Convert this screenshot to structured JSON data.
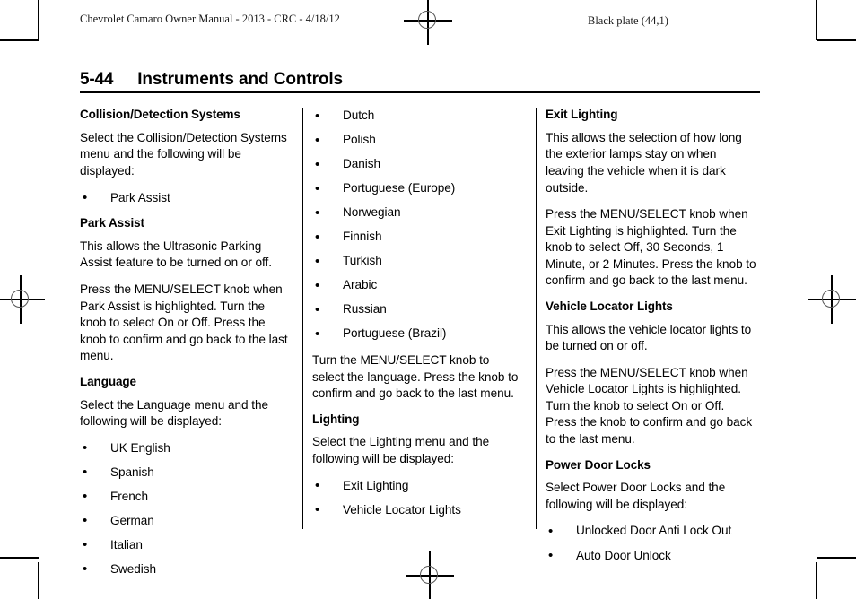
{
  "page": {
    "running_head_left": "Chevrolet Camaro Owner Manual - 2013 - CRC - 4/18/12",
    "running_head_right": "Black plate (44,1)",
    "folio": "5-44",
    "chapter_title": "Instruments and Controls",
    "bullet_glyph": "•"
  },
  "columns": {
    "left": {
      "heading_collision": "Collision/Detection Systems",
      "collision_intro": "Select the Collision/Detection Systems menu and the following will be displayed:",
      "collision_items": [
        "Park Assist"
      ],
      "heading_park_assist": "Park Assist",
      "park_assist_p1": "This allows the Ultrasonic Parking Assist feature to be turned on or off.",
      "park_assist_p2": "Press the MENU/SELECT knob when Park Assist is highlighted. Turn the knob to select On or Off. Press the knob to confirm and go back to the last menu.",
      "heading_language": "Language",
      "language_intro": "Select the Language menu and the following will be displayed:",
      "language_items": [
        "UK English",
        "Spanish",
        "French",
        "German",
        "Italian",
        "Swedish"
      ]
    },
    "middle": {
      "language_items_cont": [
        "Dutch",
        "Polish",
        "Danish",
        "Portuguese (Europe)",
        "Norwegian",
        "Finnish",
        "Turkish",
        "Arabic",
        "Russian",
        "Portuguese (Brazil)"
      ],
      "language_outro": "Turn the MENU/SELECT knob to select the language. Press the knob to confirm and go back to the last menu.",
      "heading_lighting": "Lighting",
      "lighting_intro": "Select the Lighting menu and the following will be displayed:",
      "lighting_items": [
        "Exit Lighting",
        "Vehicle Locator Lights"
      ]
    },
    "right": {
      "heading_exit_lighting": "Exit Lighting",
      "exit_lighting_p1": "This allows the selection of how long the exterior lamps stay on when leaving the vehicle when it is dark outside.",
      "exit_lighting_p2": "Press the MENU/SELECT knob when Exit Lighting is highlighted. Turn the knob to select Off, 30 Seconds, 1 Minute, or 2 Minutes. Press the knob to confirm and go back to the last menu.",
      "heading_vehicle_locator": "Vehicle Locator Lights",
      "vehicle_locator_p1": "This allows the vehicle locator lights to be turned on or off.",
      "vehicle_locator_p2": "Press the MENU/SELECT knob when Vehicle Locator Lights is highlighted. Turn the knob to select On or Off. Press the knob to confirm and go back to the last menu.",
      "heading_power_door_locks": "Power Door Locks",
      "power_door_locks_intro": "Select Power Door Locks and the following will be displayed:",
      "power_door_locks_items": [
        "Unlocked Door Anti Lock Out",
        "Auto Door Unlock"
      ]
    }
  }
}
